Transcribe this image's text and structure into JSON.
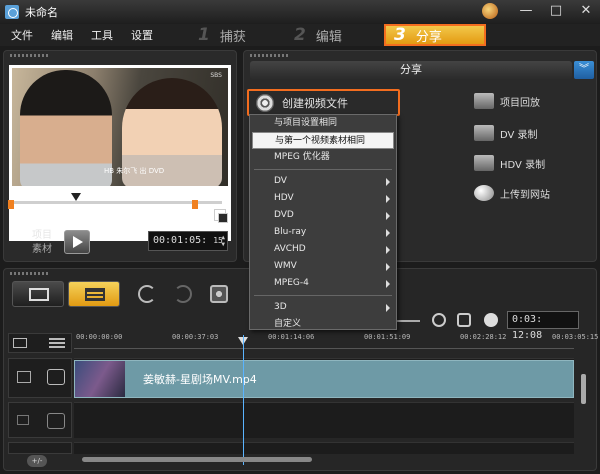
{
  "window": {
    "title": "未命名"
  },
  "menu": [
    "文件",
    "编辑",
    "工具",
    "设置"
  ],
  "steps": [
    {
      "num": "1",
      "label": "捕获"
    },
    {
      "num": "2",
      "label": "编辑"
    },
    {
      "num": "3",
      "label": "分享"
    }
  ],
  "preview": {
    "caption": "HB 朱尔飞 出 DVD",
    "logo": "SBS",
    "mode_project": "项目",
    "mode_clip": "素材",
    "timecode": "00:01:05:",
    "frame": "15"
  },
  "share": {
    "header": "分享",
    "create_video": "创建视频文件",
    "options": [
      "项目回放",
      "DV 录制",
      "HDV 录制",
      "上传到网站"
    ]
  },
  "dropdown": {
    "items": [
      {
        "label": "与项目设置相同",
        "submenu": false
      },
      {
        "label": "与第一个视频素材相同",
        "submenu": false,
        "selected": true
      },
      {
        "label": "MPEG 优化器",
        "submenu": false
      },
      {
        "label": "DV",
        "submenu": true
      },
      {
        "label": "HDV",
        "submenu": true
      },
      {
        "label": "DVD",
        "submenu": true
      },
      {
        "label": "Blu-ray",
        "submenu": true
      },
      {
        "label": "AVCHD",
        "submenu": true
      },
      {
        "label": "WMV",
        "submenu": true
      },
      {
        "label": "MPEG-4",
        "submenu": true
      },
      {
        "label": "3D",
        "submenu": true
      },
      {
        "label": "自定义",
        "submenu": false
      }
    ]
  },
  "timeline": {
    "time": "0:03: 12:08",
    "ruler": [
      "00:00:00:00",
      "00:00:37:03",
      "00:01:14:06",
      "00:01:51:09",
      "00:02:28:12",
      "00:03:05:15"
    ],
    "clip_name": "姜敏赫-星剧场MV.mp4",
    "add_track": "+/-"
  }
}
